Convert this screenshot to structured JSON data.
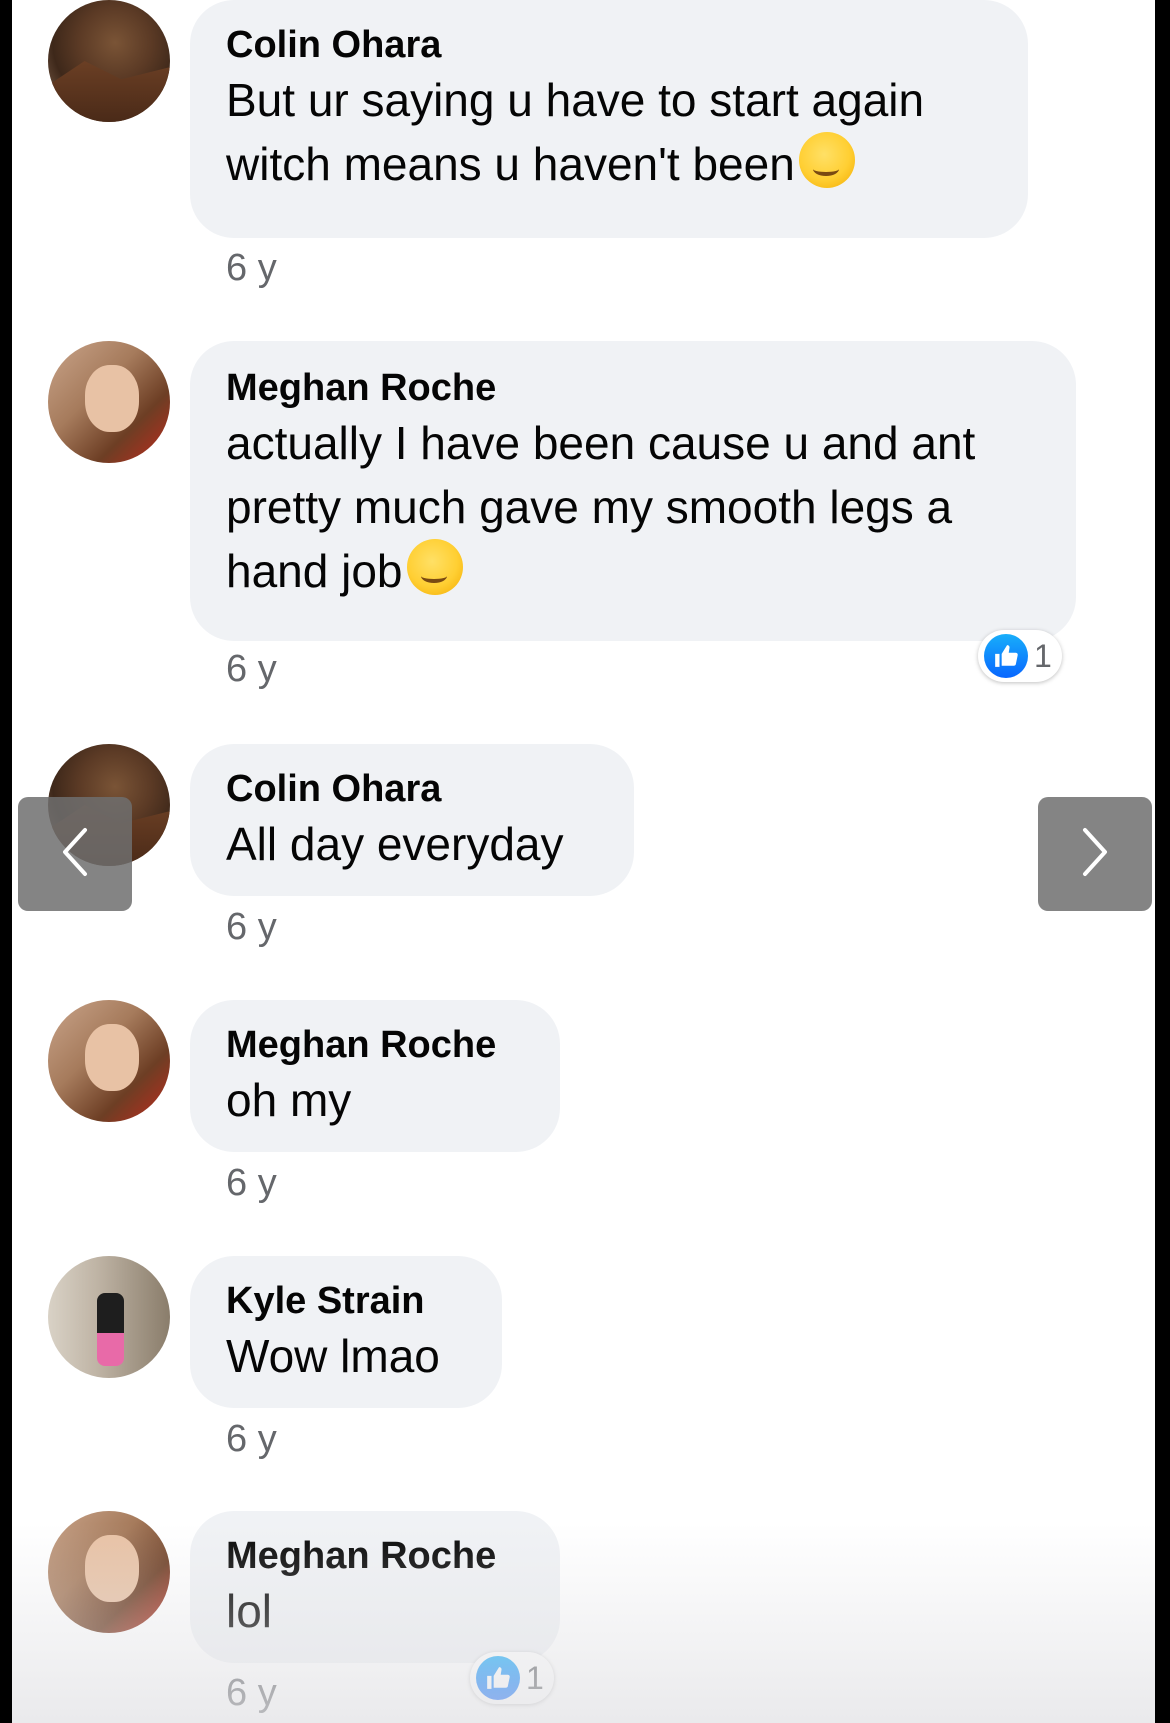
{
  "comments": [
    {
      "author": "Colin Ohara",
      "text": "But ur saying u have to start again witch means u haven't been",
      "emoji": "smirking-face",
      "time": "6 y"
    },
    {
      "author": "Meghan Roche",
      "text": "actually I have been cause u and ant pretty much gave my smooth legs a hand job",
      "emoji": "winking-face",
      "time": "6 y",
      "reaction": {
        "type": "like",
        "count": "1"
      }
    },
    {
      "author": "Colin Ohara",
      "text": "All day everyday",
      "time": "6 y"
    },
    {
      "author": "Meghan Roche",
      "text": "oh my",
      "time": "6 y"
    },
    {
      "author": "Kyle Strain",
      "text": "Wow lmao",
      "time": "6 y"
    },
    {
      "author": "Meghan Roche",
      "text": "lol",
      "time": "6 y",
      "reaction": {
        "type": "like",
        "count": "1"
      }
    }
  ],
  "navigation": {
    "prev_icon": "chevron-left-icon",
    "next_icon": "chevron-right-icon"
  },
  "colors": {
    "bubble": "#f0f2f5",
    "like": "#0866ff",
    "timestamp": "#65676b"
  }
}
